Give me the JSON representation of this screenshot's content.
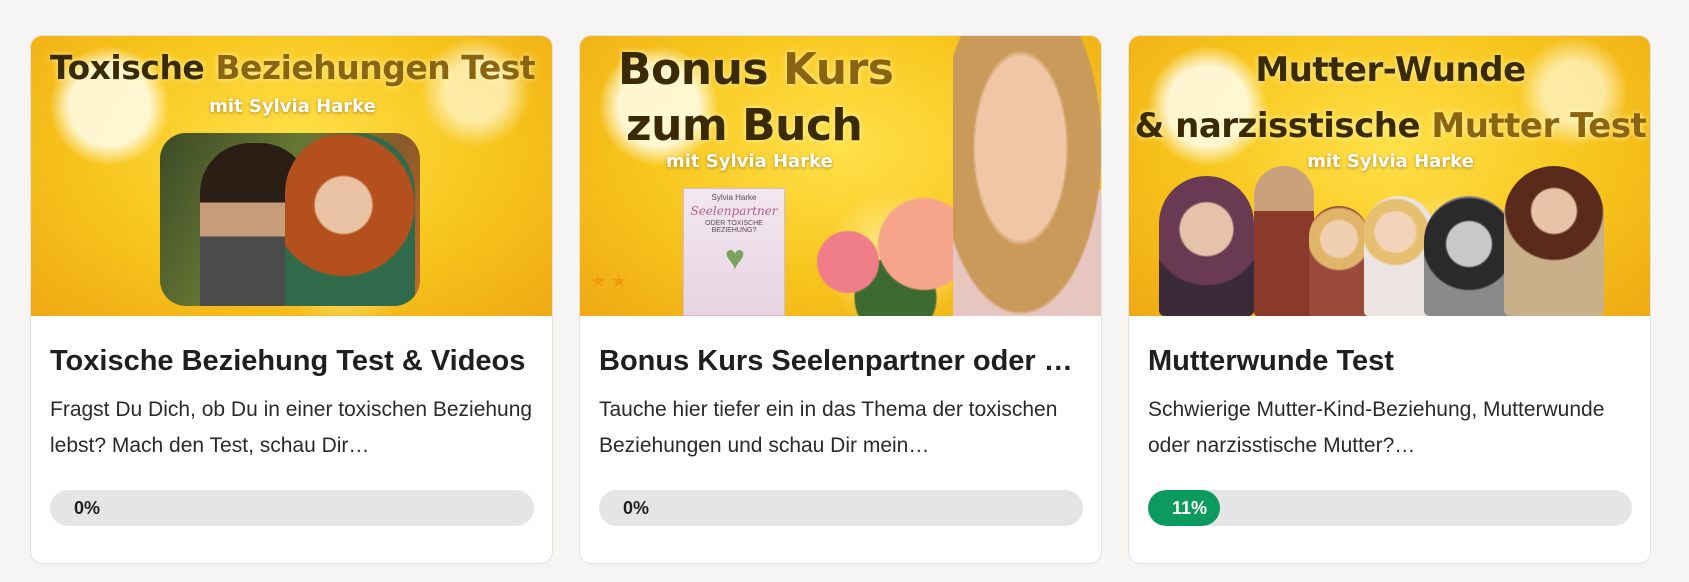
{
  "courses": [
    {
      "thumb_title_dark": "Toxische",
      "thumb_title_gold": "Beziehungen Test",
      "thumb_sub": "mit Sylvia Harke",
      "title": "Toxische Beziehung Test & Videos",
      "description": "Fragst Du Dich, ob Du in einer toxischen Beziehung lebst? Mach den Test, schau Dir…",
      "progress_percent": 0,
      "progress_label": "0%"
    },
    {
      "thumb_title_line1_dark": "Bonus",
      "thumb_title_line1_gold": "Kurs",
      "thumb_title_line2": "zum Buch",
      "thumb_sub": "mit Sylvia Harke",
      "book_author": "Sylvia Harke",
      "book_title": "Seelenpartner",
      "book_subtitle": "ODER TOXISCHE BEZIEHUNG?",
      "title": "Bonus Kurs Seelenpartner oder to…",
      "description": "Tauche hier tiefer ein in das Thema der toxischen Beziehungen und schau Dir mein…",
      "progress_percent": 0,
      "progress_label": "0%"
    },
    {
      "thumb_title_line1": "Mutter-Wunde",
      "thumb_title_line2_dark": "& narzisstische",
      "thumb_title_line2_gold": "Mutter Test",
      "thumb_sub": "mit Sylvia Harke",
      "title": "Mutterwunde Test",
      "description": "Schwierige Mutter-Kind-Beziehung, Mutterwunde oder narzisstische Mutter?…",
      "progress_percent": 11,
      "progress_label": "11%"
    }
  ],
  "colors": {
    "progress_fill": "#0c9a5e",
    "progress_track": "#e5e5e5",
    "thumb_gold": "#f7c51c"
  }
}
